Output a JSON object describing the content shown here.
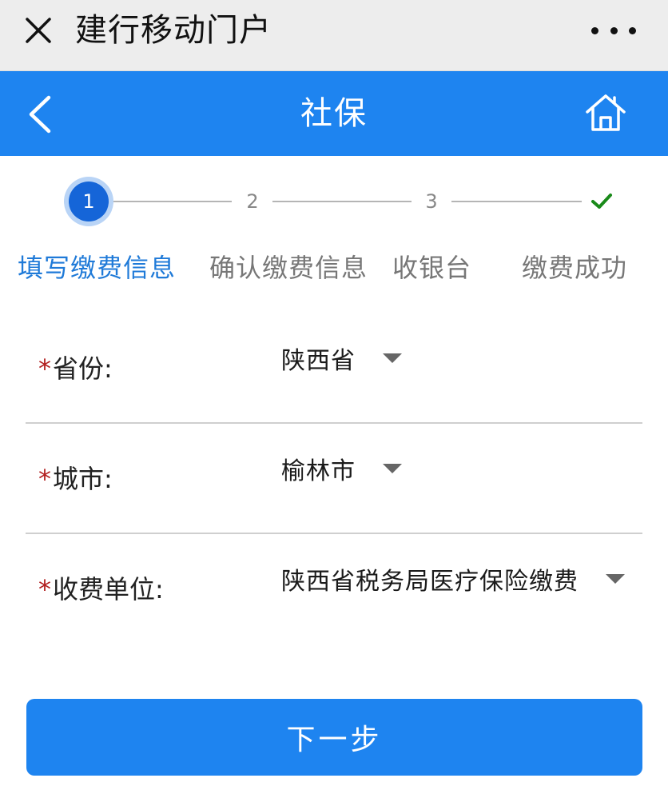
{
  "wechat_bar": {
    "title": "建行移动门户",
    "close_icon": "close-icon",
    "more_icon": "more-dots-icon"
  },
  "header": {
    "title": "社保",
    "back_icon": "chevron-left-icon",
    "home_icon": "home-icon",
    "background": "#1e84f0"
  },
  "stepper": {
    "steps": [
      {
        "number": "1",
        "label": "填写缴费信息",
        "state": "active"
      },
      {
        "number": "2",
        "label": "确认缴费信息",
        "state": "pending"
      },
      {
        "number": "3",
        "label": "收银台",
        "state": "pending"
      },
      {
        "number": "",
        "label": "缴费成功",
        "state": "pending",
        "icon": "check-icon"
      }
    ],
    "active_color": "#1565d8",
    "check_color": "#1a8a1a"
  },
  "form": {
    "required_mark": "*",
    "rows": [
      {
        "label": "省份:",
        "value": "陕西省"
      },
      {
        "label": "城市:",
        "value": "榆林市"
      },
      {
        "label": "收费单位:",
        "value": "陕西省税务局医疗保险缴费"
      }
    ]
  },
  "actions": {
    "next_label": "下一步"
  }
}
